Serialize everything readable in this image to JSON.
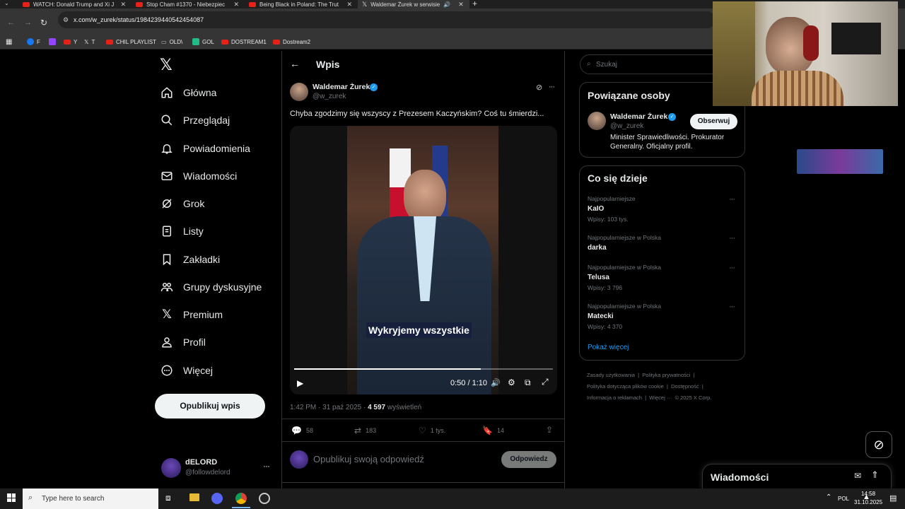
{
  "browser": {
    "tabs": [
      {
        "title": "WATCH: Donald Trump and Xi J"
      },
      {
        "title": "Stop Cham #1370 - Niebezpiec"
      },
      {
        "title": "Being Black in Poland: The Trut"
      },
      {
        "title": "Waldemar Żurek w serwisie"
      }
    ],
    "url": "x.com/w_zurek/status/1984239440542454087",
    "bookmarks": [
      "F",
      "Y",
      "T",
      "CHIL PLAYLIST",
      "OLD\\",
      "GOL",
      "DOSTREAM1",
      "Dostream2"
    ]
  },
  "nav": {
    "items": [
      "Główna",
      "Przeglądaj",
      "Powiadomienia",
      "Wiadomości",
      "Grok",
      "Listy",
      "Zakładki",
      "Grupy dyskusyjne",
      "Premium",
      "Profil",
      "Więcej"
    ],
    "post_button": "Opublikuj wpis",
    "account": {
      "name": "dELORD",
      "handle": "@followdelord"
    }
  },
  "post": {
    "header": "Wpis",
    "author": {
      "name": "Waldemar Żurek",
      "handle": "@w_zurek"
    },
    "text": "Chyba zgodzimy się wszyscy z Prezesem Kaczyńskim? Coś tu śmierdzi...",
    "video": {
      "caption": "Wykryjemy wszystkie",
      "time": "0:50 / 1:10",
      "progress": 0.72
    },
    "timestamp": "1:42 PM · 31 paź 2025 · ",
    "views_count": "4 597",
    "views_label": "wyświetleń",
    "stats": {
      "replies": "58",
      "reposts": "183",
      "likes": "1 tys.",
      "bookmarks": "14"
    },
    "reply_placeholder": "Opublikuj swoją odpowiedź",
    "reply_button": "Odpowiedz"
  },
  "sidebar": {
    "search_placeholder": "Szukaj",
    "related_title": "Powiązane osoby",
    "related": {
      "name": "Waldemar Żurek",
      "handle": "@w_zurek",
      "follow": "Obserwuj",
      "bio": "Minister Sprawiedliwości. Prokurator Generalny. Oficjalny profil."
    },
    "trends_title": "Co się dzieje",
    "trends": [
      {
        "context": "Najpopularniejsze",
        "name": "KaIO",
        "posts": "Wpisy: 103 tys."
      },
      {
        "context": "Najpopularniejsze w Polska",
        "name": "darka",
        "posts": ""
      },
      {
        "context": "Najpopularniejsze w Polska",
        "name": "Telusa",
        "posts": "Wpisy: 3 796"
      },
      {
        "context": "Najpopularniejsze w Polska",
        "name": "Matecki",
        "posts": "Wpisy: 4 370"
      }
    ],
    "show_more": "Pokaż więcej",
    "footer": [
      "Zasady użytkowania",
      "Polityka prywatności",
      "Polityka dotycząca plików cookie",
      "Dostępność",
      "Informacja o reklamach",
      "Więcej ···",
      "© 2025 X Corp."
    ]
  },
  "messages_drawer": {
    "title": "Wiadomości"
  },
  "taskbar": {
    "search": "Type here to search",
    "lang": "POL",
    "time": "14:58",
    "date": "31.10.2025"
  }
}
